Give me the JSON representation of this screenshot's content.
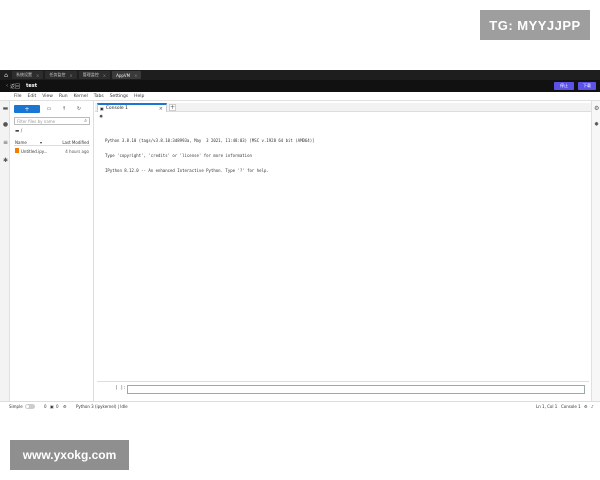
{
  "watermarks": {
    "top": "TG: MYYJJPP",
    "bottom": "www.yxokg.com"
  },
  "browser_tabs": [
    {
      "label": "系统设置",
      "close": "×"
    },
    {
      "label": "任务监控",
      "close": "×"
    },
    {
      "label": "管理监控",
      "close": "×"
    },
    {
      "label": "AppVM",
      "close": "×"
    }
  ],
  "titlebar": {
    "back_label": "返回",
    "project": "test",
    "btn_primary": "停止",
    "btn_secondary": "下载"
  },
  "menu": [
    "File",
    "Edit",
    "View",
    "Run",
    "Kernel",
    "Tabs",
    "Settings",
    "Help"
  ],
  "file_panel": {
    "new_label": "+",
    "search_placeholder": "Filter files by name",
    "crumb": "/",
    "col_name": "Name",
    "col_modified": "Last Modified",
    "files": [
      {
        "name": "Untitled.ipy...",
        "modified": "4 hours ago"
      }
    ]
  },
  "console": {
    "tab_label": "Console 1",
    "output": [
      "Python 3.8.10 (tags/v3.8.10:3d8993a, May  3 2021, 11:48:03) [MSC v.1928 64 bit (AMD64)]",
      "Type 'copyright', 'credits' or 'license' for more information",
      "IPython 8.12.0 -- An enhanced Interactive Python. Type '?' for help."
    ],
    "prompt": "[ ]:"
  },
  "status": {
    "mode": "Simple",
    "count_a": "0",
    "count_b": "0",
    "kernel": "Python 3 (ipykernel) | Idle",
    "position": "Ln 1, Col 1",
    "console": "Console 1"
  }
}
